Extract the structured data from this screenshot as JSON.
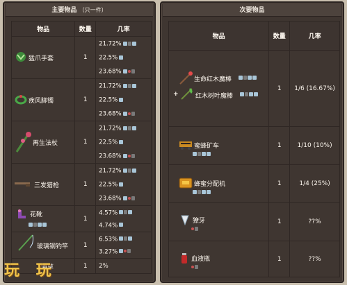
{
  "left_panel": {
    "title": "主要物品",
    "title_note": "（只一件）",
    "headers": [
      "物品",
      "数量",
      "几率"
    ],
    "rows": [
      {
        "name": "猛爪手套",
        "icon": "claw-glove-icon",
        "qty": "1",
        "chances": [
          "21.72%",
          "22.5%",
          "23.68%"
        ]
      },
      {
        "name": "疾风脚镯",
        "icon": "anklet-icon",
        "qty": "1",
        "chances": [
          "21.72%",
          "22.5%",
          "23.68%"
        ]
      },
      {
        "name": "再生法杖",
        "icon": "staff-icon",
        "qty": "1",
        "chances": [
          "21.72%",
          "22.5%",
          "23.68%"
        ]
      },
      {
        "name": "三发猎枪",
        "icon": "shotgun-icon",
        "qty": "1",
        "chances": [
          "21.72%",
          "22.5%",
          "23.68%"
        ]
      },
      {
        "name": "花靴",
        "icon": "flower-boots-icon",
        "qty": "1",
        "chances": [
          "4.57%",
          "4.74%"
        ]
      },
      {
        "name": "玻璃钢钓竿",
        "icon": "fishing-rod-icon",
        "qty": "1",
        "chances": [
          "6.53%",
          "3.27%"
        ]
      },
      {
        "name": "海草",
        "icon": "seaweed-icon",
        "qty": "1",
        "chances": [
          "2%"
        ]
      }
    ]
  },
  "right_panel": {
    "title": "次要物品",
    "headers": [
      "物品",
      "数量",
      "几率"
    ],
    "rows": [
      {
        "names": [
          "生命红木魔棒",
          "红木树叶魔棒"
        ],
        "plus": "+",
        "icons": [
          "wand-icon",
          "leaf-wand-icon"
        ],
        "qty": "1",
        "chance": "1/6 (16.67%)"
      },
      {
        "names": [
          "蜜蜂矿车"
        ],
        "icons": [
          "bee-minecart-icon"
        ],
        "qty": "1",
        "chance": "1/10 (10%)"
      },
      {
        "names": [
          "蜂蜜分配机"
        ],
        "icons": [
          "honey-dispenser-icon"
        ],
        "qty": "1",
        "chance": "1/4 (25%)"
      },
      {
        "names": [
          "獠牙"
        ],
        "icons": [
          "fang-icon"
        ],
        "qty": "1",
        "chance": "??%"
      },
      {
        "names": [
          "血液瓶"
        ],
        "icons": [
          "blood-vial-icon"
        ],
        "qty": "1",
        "chance": "??%"
      }
    ]
  },
  "watermark": "玩 玩",
  "colors": {
    "panel": "#3f3631",
    "border": "#2a2320",
    "watermark": "#f1c44a"
  }
}
